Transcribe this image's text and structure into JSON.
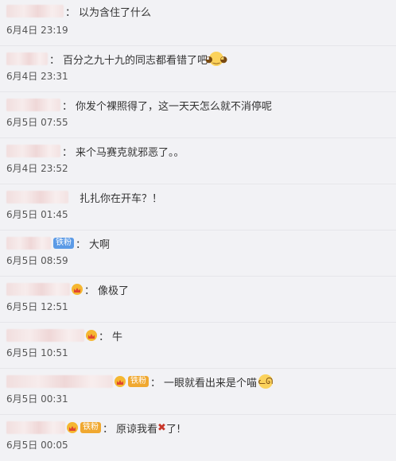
{
  "comments": [
    {
      "colon": "：",
      "text": "以为含住了什么",
      "time": "6月4日 23:19"
    },
    {
      "colon": "：",
      "text": "百分之九十九的同志都看错了吧",
      "emoji": "doge-emoji",
      "time": "6月4日 23:31"
    },
    {
      "colon": "：",
      "text": "你发个裸照得了，这一天天怎么就不消停呢",
      "time": "6月5日 07:55"
    },
    {
      "colon": "：",
      "text": "来个马赛克就邪恶了。。",
      "time": "6月4日 23:52"
    },
    {
      "colon": "",
      "text": "扎扎你在开车？！",
      "time": "6月5日 01:45"
    },
    {
      "badge": "铁粉",
      "colon": "：",
      "text": "大啊",
      "time": "6月5日 08:59"
    },
    {
      "colon": "：",
      "text": "像极了",
      "time": "6月5日 12:51"
    },
    {
      "colon": "：",
      "text": "牛",
      "time": "6月5日 10:51"
    },
    {
      "badge": "铁粉",
      "colon": "：",
      "text": "一眼就看出来是个喵",
      "emoji": "cat-emoji",
      "time": "6月5日 00:31"
    },
    {
      "badge": "铁粉",
      "colon": "：",
      "text": "原谅我看",
      "after": "了!",
      "emoji": "cross-icon",
      "time": "6月5日 00:05"
    }
  ]
}
